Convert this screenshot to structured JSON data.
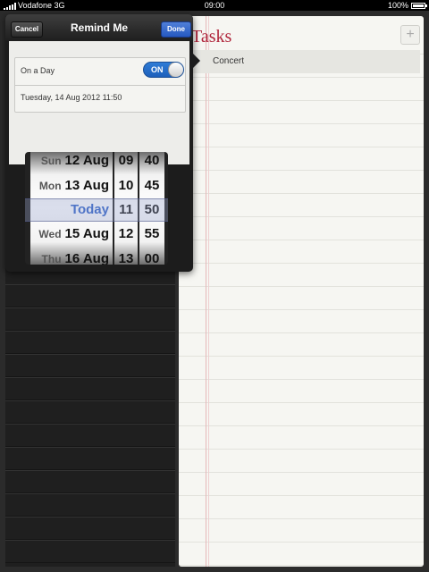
{
  "status_bar": {
    "carrier": "Vodafone 3G",
    "time": "09:00",
    "battery": "100%"
  },
  "notepad": {
    "title": "Tasks",
    "add_label": "+",
    "tasks": [
      {
        "label": "Concert"
      }
    ]
  },
  "popover": {
    "title": "Remind Me",
    "cancel_label": "Cancel",
    "done_label": "Done",
    "on_a_day_label": "On a Day",
    "toggle_label": "ON",
    "date_value": "Tuesday, 14 Aug 2012 11:50"
  },
  "picker": {
    "dates": [
      {
        "weekday": "Sun",
        "date": "12 Aug"
      },
      {
        "weekday": "Mon",
        "date": "13 Aug"
      },
      {
        "weekday": "",
        "date": "Today"
      },
      {
        "weekday": "Wed",
        "date": "15 Aug"
      },
      {
        "weekday": "Thu",
        "date": "16 Aug"
      }
    ],
    "hours": [
      "09",
      "10",
      "11",
      "12",
      "13"
    ],
    "minutes": [
      "40",
      "45",
      "50",
      "55",
      "00"
    ]
  },
  "colors": {
    "accent": "#2659c0",
    "tasks_title": "#b0263c",
    "toggle_on": "#2f7cd6"
  }
}
